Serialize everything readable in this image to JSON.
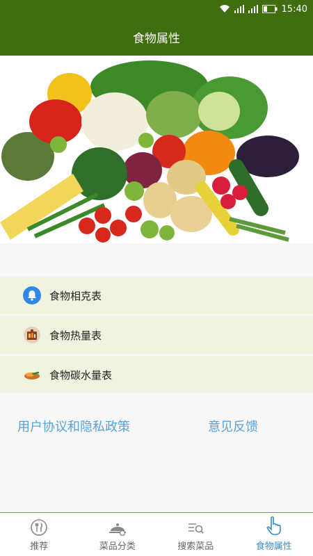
{
  "status_bar": {
    "time": "15:40"
  },
  "app_bar": {
    "title": "食物属性"
  },
  "menu": [
    {
      "label": "食物相克表",
      "icon": "bell-icon"
    },
    {
      "label": "食物热量表",
      "icon": "calorie-chart-icon"
    },
    {
      "label": "食物碳水量表",
      "icon": "carb-food-icon"
    }
  ],
  "links": {
    "privacy": "用户协议和隐私政策",
    "feedback": "意见反馈"
  },
  "tabs": [
    {
      "label": "推荐",
      "icon": "cutlery-icon",
      "active": false
    },
    {
      "label": "菜品分类",
      "icon": "dish-cover-icon",
      "active": false
    },
    {
      "label": "搜索菜品",
      "icon": "search-list-icon",
      "active": false
    },
    {
      "label": "食物属性",
      "icon": "hand-pointer-icon",
      "active": true
    }
  ],
  "colors": {
    "header": "#3f6d0f",
    "menu_background": "#f0f3df",
    "link": "#58a2da",
    "tab_active": "#3a8cc8"
  }
}
